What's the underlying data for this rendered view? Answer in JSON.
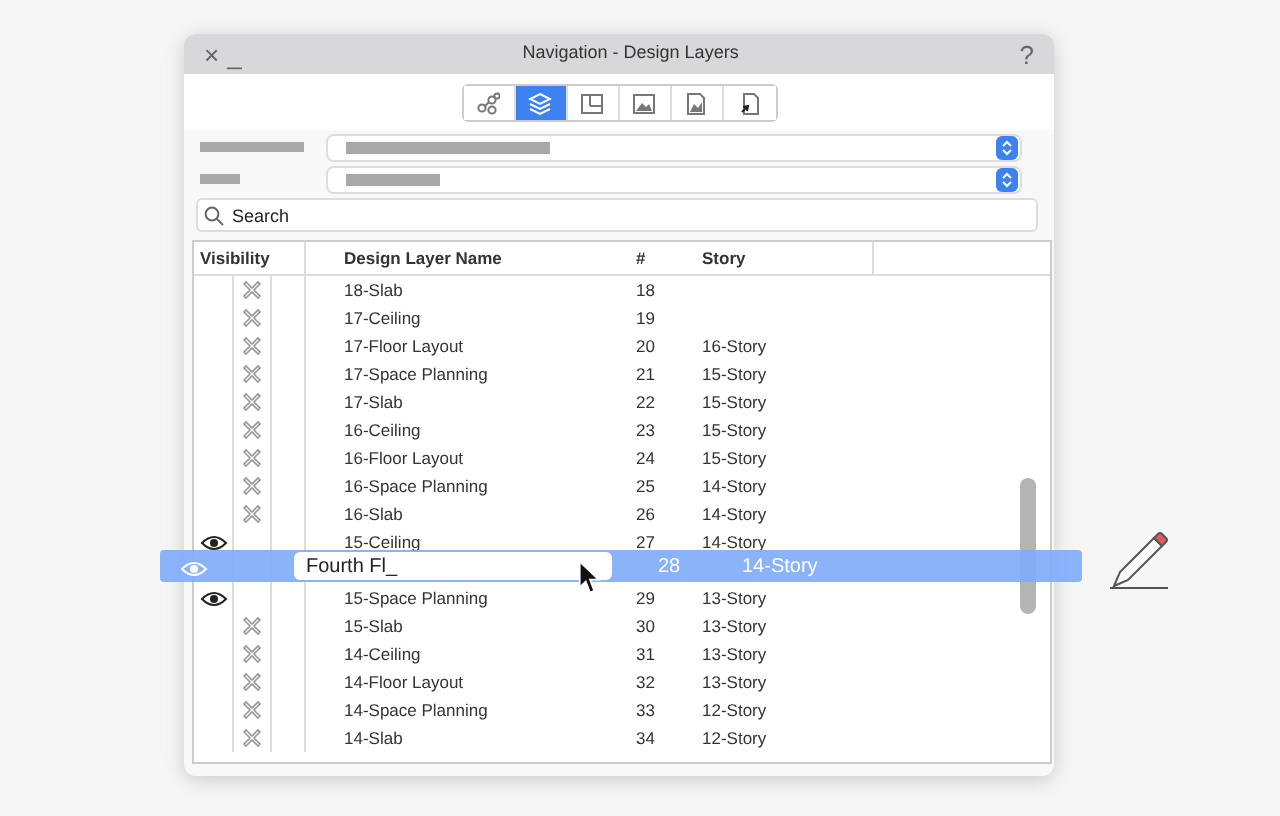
{
  "window": {
    "title": "Navigation - Design Layers",
    "close": "×",
    "minimize": "_",
    "help": "?"
  },
  "tabs": [
    {
      "selected": false
    },
    {
      "selected": true
    },
    {
      "selected": false
    },
    {
      "selected": false
    },
    {
      "selected": false
    },
    {
      "selected": false
    }
  ],
  "dropdowns": [
    {
      "kind": "dropdown"
    },
    {
      "kind": "dropdown"
    }
  ],
  "search": {
    "placeholder": "Search"
  },
  "table": {
    "columns": [
      "Visibility",
      "Design Layer Name",
      "#",
      "Story"
    ],
    "rows": [
      {
        "kind": "row",
        "visible": false,
        "name": "18-Slab",
        "number": "18",
        "story": ""
      },
      {
        "kind": "row",
        "visible": false,
        "name": "17-Ceiling",
        "number": "19",
        "story": ""
      },
      {
        "kind": "row",
        "visible": false,
        "name": "17-Floor Layout",
        "number": "20",
        "story": "16-Story"
      },
      {
        "kind": "row",
        "visible": false,
        "name": "17-Space Planning",
        "number": "21",
        "story": "15-Story"
      },
      {
        "kind": "row",
        "visible": false,
        "name": "17-Slab",
        "number": "22",
        "story": "15-Story"
      },
      {
        "kind": "row",
        "visible": false,
        "name": "16-Ceiling",
        "number": "23",
        "story": "15-Story"
      },
      {
        "kind": "row",
        "visible": false,
        "name": "16-Floor Layout",
        "number": "24",
        "story": "15-Story"
      },
      {
        "kind": "row",
        "visible": false,
        "name": "16-Space Planning",
        "number": "25",
        "story": "14-Story"
      },
      {
        "kind": "row",
        "visible": false,
        "name": "16-Slab",
        "number": "26",
        "story": "14-Story"
      },
      {
        "kind": "row",
        "visible": true,
        "name": "15-Ceiling",
        "number": "27",
        "story": "14-Story"
      },
      {
        "kind": "dragged",
        "visible": true,
        "name": "Fourth Fl_",
        "number": "28",
        "story": "14-Story"
      },
      {
        "kind": "row",
        "visible": true,
        "name": "15-Space Planning",
        "number": "29",
        "story": "13-Story"
      },
      {
        "kind": "row",
        "visible": false,
        "name": "15-Slab",
        "number": "30",
        "story": "13-Story"
      },
      {
        "kind": "row",
        "visible": false,
        "name": "14-Ceiling",
        "number": "31",
        "story": "13-Story"
      },
      {
        "kind": "row",
        "visible": false,
        "name": "14-Floor Layout",
        "number": "32",
        "story": "13-Story"
      },
      {
        "kind": "row",
        "visible": false,
        "name": "14-Space Planning",
        "number": "33",
        "story": "12-Story"
      },
      {
        "kind": "row",
        "visible": false,
        "name": "14-Slab",
        "number": "34",
        "story": "12-Story"
      }
    ]
  }
}
